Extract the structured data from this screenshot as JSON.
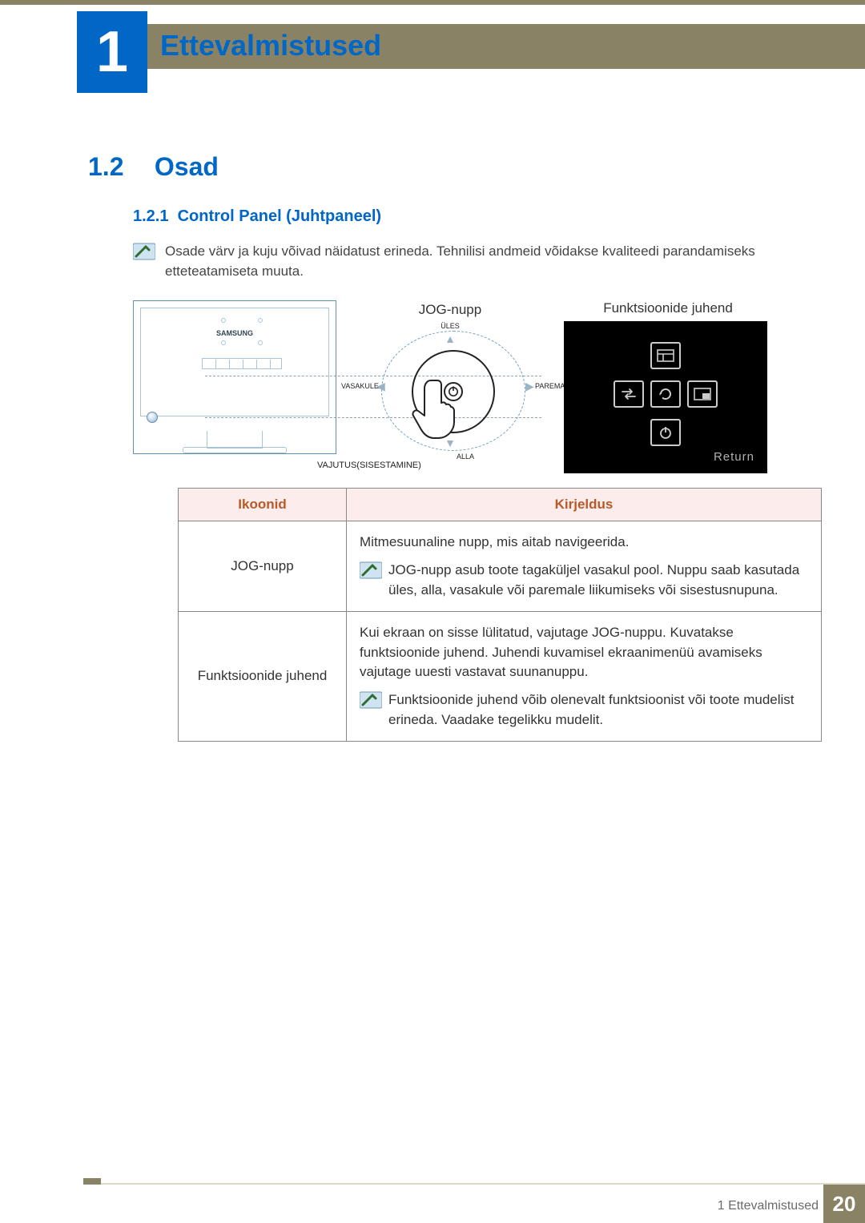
{
  "chapter": {
    "number": "1",
    "title": "Ettevalmistused"
  },
  "section": {
    "number": "1.2",
    "title": "Osad"
  },
  "subsection": {
    "number": "1.2.1",
    "title": "Control Panel (Juhtpaneel)"
  },
  "lead_note": "Osade värv ja kuju võivad näidatust erineda. Tehnilisi andmeid võidakse kvaliteedi parandamiseks etteteatamiseta muuta.",
  "figure": {
    "brand": "SAMSUNG",
    "jog_label": "JOG-nupp",
    "dir_up": "ÜLES",
    "dir_down": "ALLA",
    "dir_left": "VASAKULE",
    "dir_right": "PAREMALE",
    "press_label": "VAJUTUS(SISESTAMINE)",
    "osd_caption": "Funktsioonide juhend",
    "osd_return": "Return"
  },
  "table": {
    "headers": {
      "icons": "Ikoonid",
      "desc": "Kirjeldus"
    },
    "rows": [
      {
        "icon": "JOG-nupp",
        "desc_main": "Mitmesuunaline nupp, mis aitab navigeerida.",
        "desc_note": "JOG-nupp asub toote tagaküljel vasakul pool. Nuppu saab kasutada üles, alla, vasakule või paremale liikumiseks või sisestusnupuna."
      },
      {
        "icon": "Funktsioonide juhend",
        "desc_main": "Kui ekraan on sisse lülitatud, vajutage JOG-nuppu. Kuvatakse funktsioonide juhend. Juhendi kuvamisel ekraanimenüü avamiseks vajutage uuesti vastavat suunanuppu.",
        "desc_note": "Funktsioonide juhend võib olenevalt funktsioonist või toote mudelist erineda. Vaadake tegelikku mudelit."
      }
    ]
  },
  "footer": {
    "caption": "1 Ettevalmistused",
    "page": "20"
  }
}
